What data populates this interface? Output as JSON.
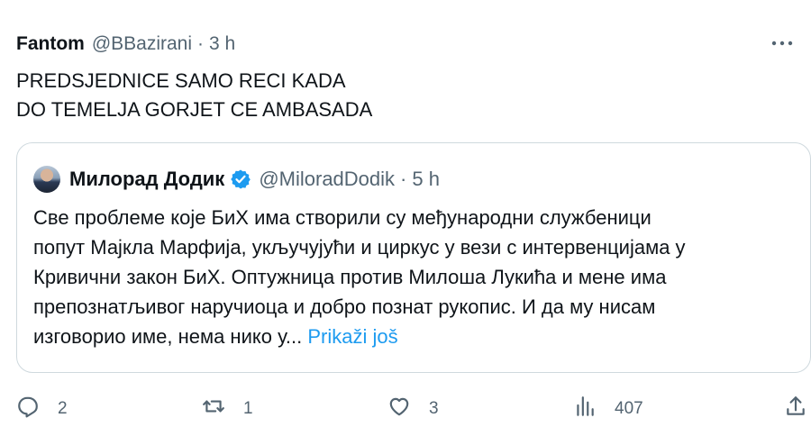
{
  "tweet": {
    "author_name": "Fantom",
    "author_handle": "@BBazirani",
    "separator": "·",
    "time": "3 h",
    "text_lines": [
      "PREDSJEDNICE SAMO RECI KADA",
      "DO TEMELJA GORJET CE AMBASADA"
    ]
  },
  "quoted": {
    "author_name": "Милорад Додик",
    "author_handle": "@MiloradDodik",
    "separator": "·",
    "time": "5 h",
    "text_lines": [
      "Све проблеме које БиХ има створили су међународни службеници",
      "попут Мајкла Марфија, укључујући и циркус у вези с интервенцијама у",
      "Кривични закон БиХ. Оптужница против Милоша Лукића и мене има",
      "препознатљивог наручиоца и добро познат рукопис. И да му нисам",
      "изговорио име, нема нико у..."
    ],
    "show_more": "Prikaži još"
  },
  "actions": {
    "replies": "2",
    "reposts": "1",
    "likes": "3",
    "views": "407"
  },
  "icons": [
    "more-icon",
    "verified-badge-icon",
    "reply-icon",
    "repost-icon",
    "like-icon",
    "views-icon",
    "share-icon"
  ],
  "colors": {
    "link": "#1d9bf0",
    "secondary": "#536471",
    "text": "#0f1419",
    "border": "#cfd9de"
  }
}
